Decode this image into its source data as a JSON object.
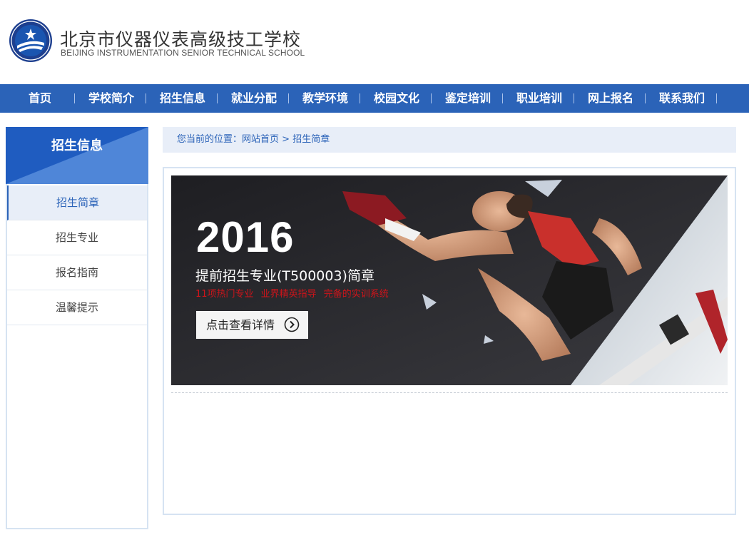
{
  "header": {
    "school_name_cn": "北京市仪器仪表高级技工学校",
    "school_name_en": "BEIJING INSTRUMENTATION SENIOR TECHNICAL SCHOOL"
  },
  "nav": {
    "items": [
      {
        "label": "首页"
      },
      {
        "label": "学校简介"
      },
      {
        "label": "招生信息"
      },
      {
        "label": "就业分配"
      },
      {
        "label": "教学环境"
      },
      {
        "label": "校园文化"
      },
      {
        "label": "鉴定培训"
      },
      {
        "label": "职业培训"
      },
      {
        "label": "网上报名"
      },
      {
        "label": "联系我们"
      }
    ]
  },
  "sidebar": {
    "title": "招生信息",
    "items": [
      {
        "label": "招生简章",
        "active": true
      },
      {
        "label": "招生专业"
      },
      {
        "label": "报名指南"
      },
      {
        "label": "温馨提示"
      }
    ]
  },
  "breadcrumb": {
    "prefix": "您当前的位置：",
    "home": "网站首页",
    "separator": " > ",
    "current": "招生简章"
  },
  "banner": {
    "year": "2016",
    "subtitle": "提前招生专业(T500003)简章",
    "tags": "11项热门专业   业界精英指导   完备的实训系统",
    "button_label": "点击查看详情",
    "button_icon": "circle-arrow-right-icon"
  },
  "colors": {
    "nav_blue": "#2b63b8",
    "crumb_bg": "#e8eef8",
    "tag_red": "#d0141a"
  }
}
